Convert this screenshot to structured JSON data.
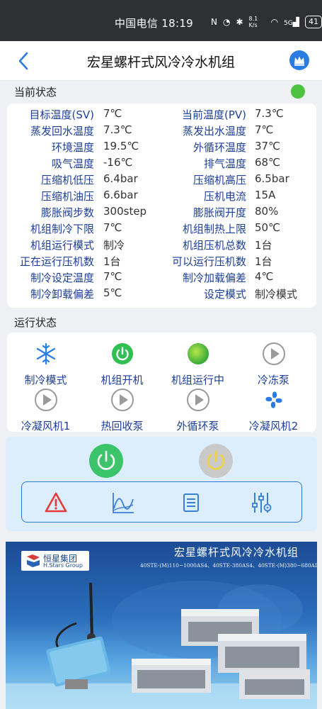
{
  "status_bar": {
    "carrier": "中国电信",
    "time": "18:19",
    "net_speed": "8.1 K/s",
    "signal": "5G",
    "battery": "41"
  },
  "header": {
    "title": "宏星螺杆式风冷冷水机组"
  },
  "sections": {
    "current_status": "当前状态",
    "run_status": "运行状态"
  },
  "online_color": "#4cc23e",
  "params": [
    {
      "l1": "目标温度(SV)",
      "v1": "7℃",
      "l2": "当前温度(PV)",
      "v2": "7.3℃"
    },
    {
      "l1": "蒸发回水温度",
      "v1": "7.3℃",
      "l2": "蒸发出水温度",
      "v2": "7℃"
    },
    {
      "l1": "环境温度",
      "v1": "19.5℃",
      "l2": "外循环温度",
      "v2": "37℃"
    },
    {
      "l1": "吸气温度",
      "v1": "-16℃",
      "l2": "排气温度",
      "v2": "68℃"
    },
    {
      "l1": "压缩机低压",
      "v1": "6.4bar",
      "l2": "压缩机高压",
      "v2": "6.5bar"
    },
    {
      "l1": "压缩机油压",
      "v1": "6.6bar",
      "l2": "压机电流",
      "v2": "15A"
    },
    {
      "l1": "膨胀阀步数",
      "v1": "300step",
      "l2": "膨胀阀开度",
      "v2": "80%"
    },
    {
      "l1": "机组制冷下限",
      "v1": "7℃",
      "l2": "机组制热上限",
      "v2": "50℃"
    },
    {
      "l1": "机组运行模式",
      "v1": "制冷",
      "l2": "机组压机总数",
      "v2": "1台"
    },
    {
      "l1": "正在运行压机数",
      "v1": "1台",
      "l2": "可以运行压机数",
      "v2": "1台"
    },
    {
      "l1": "制冷设定温度",
      "v1": "7℃",
      "l2": "制冷加载偏差",
      "v2": "4℃"
    },
    {
      "l1": "制冷卸载偏差",
      "v1": "5℃",
      "l2": "设定模式",
      "v2": "制冷模式"
    }
  ],
  "run_items": [
    {
      "label": "制冷模式",
      "icon": "snowflake-icon"
    },
    {
      "label": "机组开机",
      "icon": "power-on-icon"
    },
    {
      "label": "机组运行中",
      "icon": "running-indicator-icon"
    },
    {
      "label": "冷冻泵",
      "icon": "play-icon"
    },
    {
      "label": "冷凝风机1",
      "icon": "play-icon"
    },
    {
      "label": "热回收泵",
      "icon": "play-icon"
    },
    {
      "label": "外循环泵",
      "icon": "play-icon"
    },
    {
      "label": "冷凝风机2",
      "icon": "fan-icon"
    }
  ],
  "controls": {
    "power_on_color": "#3cc46a",
    "power_off_color": "#c9c9c9",
    "tools": [
      "alarm-icon",
      "chart-icon",
      "list-icon",
      "settings-sliders-icon"
    ]
  },
  "banner": {
    "company_cn": "恒星集团",
    "company_en": "H.Stars Group",
    "title": "宏星螺杆式风冷冷水机组",
    "models": "40STE-(M)110~1000AS4、40STE-380AS4、40STE-(M)380~680AD4"
  }
}
